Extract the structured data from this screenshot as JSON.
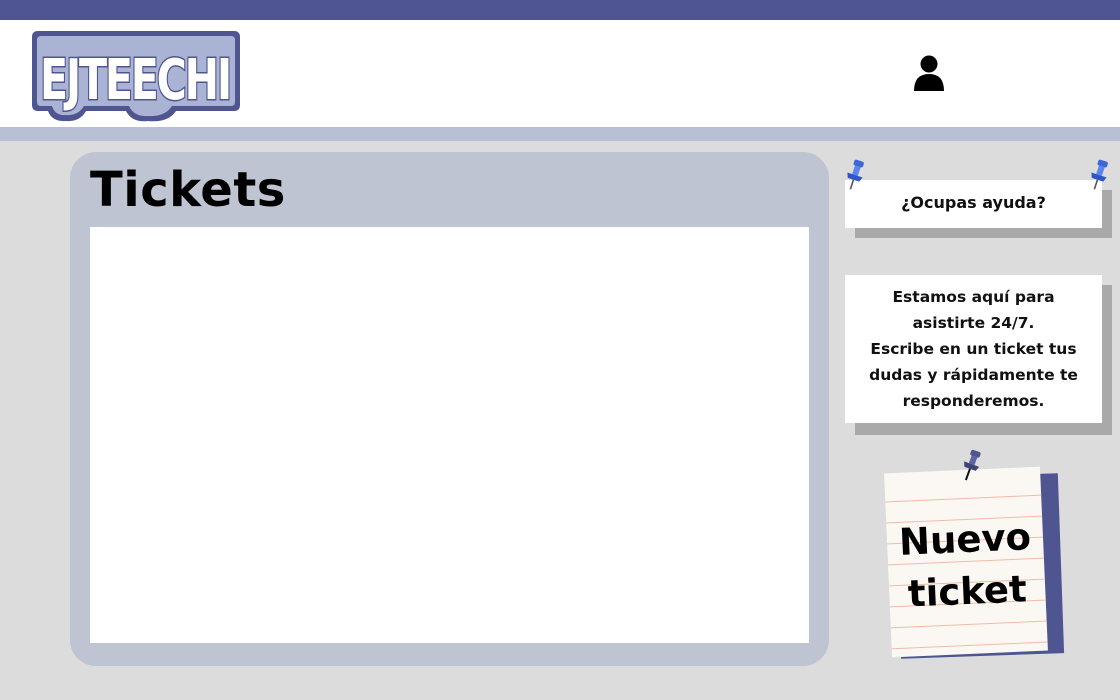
{
  "header": {
    "logo_text": "EJTEECHI",
    "user_icon": "user-icon"
  },
  "tickets": {
    "title": "Tickets",
    "items": []
  },
  "sidebar": {
    "help_title": "¿Ocupas ayuda?",
    "info_lines": [
      "Estamos aquí para",
      "asistirte 24/7.",
      "Escribe en un ticket tus",
      "dudas y rápidamente te",
      "responderemos."
    ],
    "new_ticket": {
      "line1": "Nuevo",
      "line2": "ticket"
    },
    "pin_icon": "pushpin-icon"
  },
  "colors": {
    "brand": "#4e5590",
    "header_underline": "#b9c0d6",
    "panel": "#bec4d2",
    "background": "#dcdcdc",
    "pin": "#4a6fd6"
  }
}
